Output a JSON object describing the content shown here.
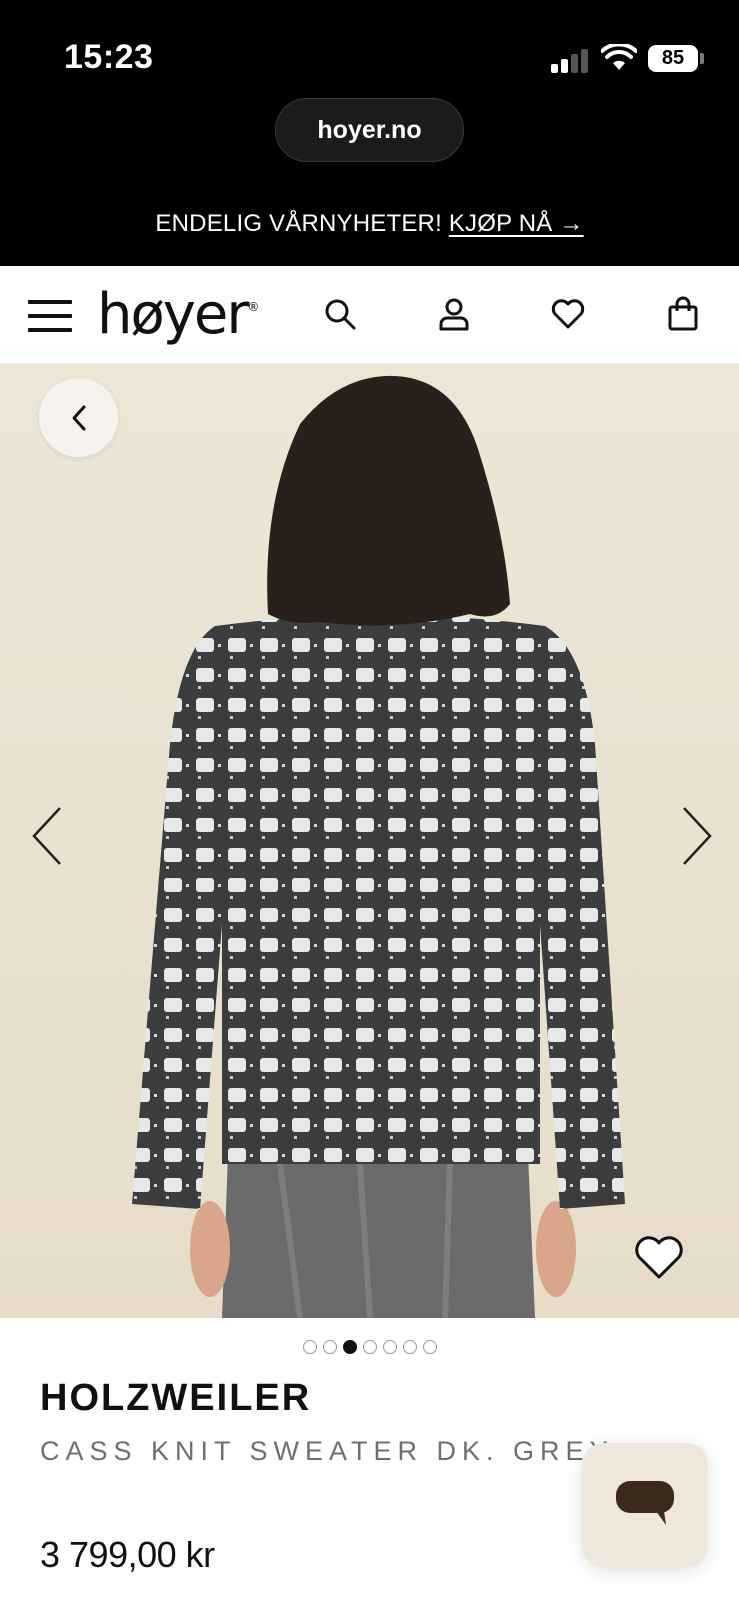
{
  "status_bar": {
    "time": "15:23",
    "battery": "85"
  },
  "browser": {
    "url": "hoyer.no"
  },
  "promo": {
    "text": "ENDELIG VÅRNYHETER! ",
    "link": "KJØP NÅ →"
  },
  "header": {
    "logo": "høyer",
    "logo_mark": "®",
    "icons": [
      "menu-icon",
      "search-icon",
      "account-icon",
      "heart-icon",
      "bag-icon"
    ]
  },
  "gallery": {
    "image_count": 7,
    "active_index": 2,
    "background_color": "#ebe4d4"
  },
  "product": {
    "brand": "HOLZWEILER",
    "name": "CASS KNIT SWEATER DK. GREY",
    "price": "3 799,00 kr"
  },
  "colors": {
    "accent": "#111111",
    "chat_bg": "#efe7db",
    "chat_icon": "#3a2a1c"
  }
}
